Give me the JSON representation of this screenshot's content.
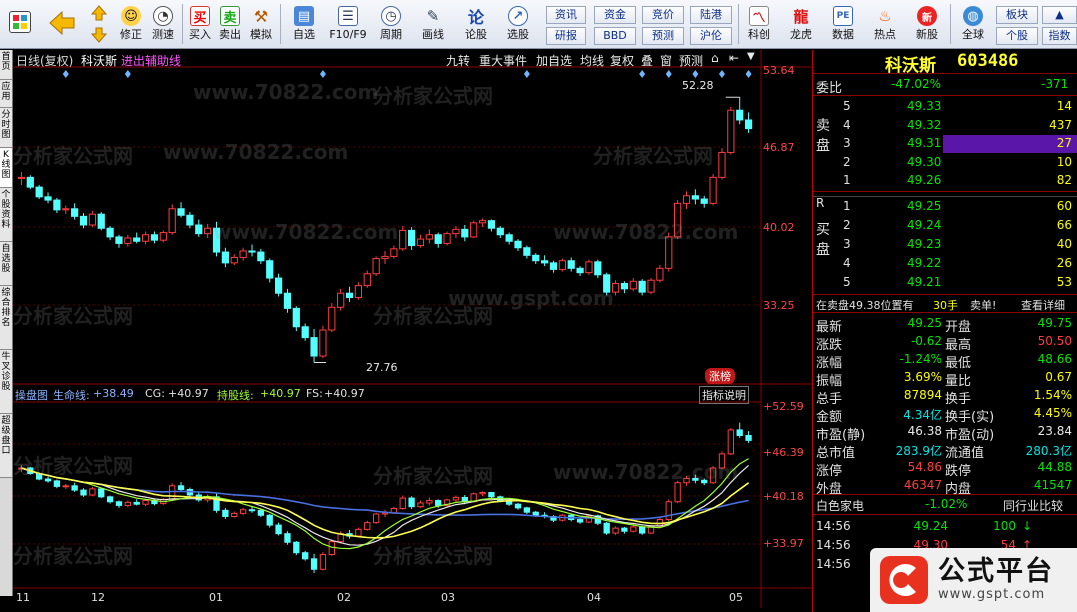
{
  "toolbar": {
    "buttons": [
      {
        "label": "修正",
        "icon": "refresh-icon"
      },
      {
        "label": "测速",
        "icon": "stopwatch-icon"
      },
      {
        "label": "买入",
        "icon": "buy-icon"
      },
      {
        "label": "卖出",
        "icon": "sell-icon"
      },
      {
        "label": "模拟",
        "icon": "gavel-icon"
      },
      {
        "label": "自选",
        "icon": "folder-icon"
      },
      {
        "label": "F10/F9",
        "icon": "document-icon"
      },
      {
        "label": "周期",
        "icon": "clock-icon"
      },
      {
        "label": "画线",
        "icon": "pencil-icon"
      },
      {
        "label": "论股",
        "icon": "discussion-icon"
      },
      {
        "label": "选股",
        "icon": "pick-stock-icon"
      },
      {
        "label": "科创",
        "icon": "chart-icon"
      },
      {
        "label": "龙虎",
        "icon": "dragon-icon"
      },
      {
        "label": "数据",
        "icon": "pe-icon"
      },
      {
        "label": "热点",
        "icon": "hot-icon"
      },
      {
        "label": "新股",
        "icon": "new-stock-icon"
      },
      {
        "label": "全球",
        "icon": "globe-icon"
      }
    ],
    "small_buttons": [
      "资讯",
      "资金",
      "竞价",
      "陆港",
      "研报",
      "BBD",
      "预测",
      "沪伦",
      "板块",
      "个股",
      "指数"
    ]
  },
  "vtabs": [
    "首页",
    "应用",
    "分时图",
    "K线图",
    "个股资料",
    "自选股",
    "综合排名",
    "牛叉诊股",
    "超级盘口"
  ],
  "chart_header": {
    "period": "日线(复权)",
    "stock_name": "科沃斯",
    "aux": "进出辅助线",
    "menu": [
      "九转",
      "重大事件",
      "加自选",
      "均线",
      "复权",
      "叠",
      "窗",
      "预测"
    ]
  },
  "main_axis": {
    "ticks": [
      "53.64",
      "46.87",
      "40.02",
      "33.25"
    ],
    "high_label": "52.28",
    "low_label": "27.76"
  },
  "sub_header": {
    "name": "操盘图",
    "life_label": "生命线:",
    "life_value": "+38.49",
    "cg_label": "CG:",
    "cg_value": "+40.97",
    "hold_label": "持股线:",
    "hold_value": "+40.97",
    "fs_label": "FS:",
    "fs_value": "+40.97",
    "indicator_btn": "指标说明",
    "badge": "涨榜"
  },
  "sub_axis": {
    "ticks": [
      "+52.59",
      "+46.39",
      "+40.18",
      "+33.97"
    ]
  },
  "x_axis": {
    "labels": [
      "11",
      "12",
      "01",
      "02",
      "03",
      "04",
      "05"
    ]
  },
  "chart_data": {
    "type": "candlestick",
    "ylim": [
      26,
      55
    ],
    "candles": [
      [
        44.8,
        45.4,
        44.2,
        44.9
      ],
      [
        44.9,
        45.1,
        43.8,
        44.0
      ],
      [
        44.0,
        44.2,
        42.9,
        43.1
      ],
      [
        43.1,
        43.5,
        42.5,
        42.8
      ],
      [
        42.8,
        43.0,
        41.6,
        41.9
      ],
      [
        41.9,
        42.3,
        41.5,
        42.0
      ],
      [
        42.0,
        42.5,
        41.0,
        41.3
      ],
      [
        41.3,
        41.6,
        40.2,
        40.5
      ],
      [
        40.5,
        41.8,
        40.3,
        41.5
      ],
      [
        41.5,
        41.7,
        40.0,
        40.2
      ],
      [
        40.2,
        40.4,
        39.1,
        39.4
      ],
      [
        39.4,
        39.6,
        38.4,
        38.8
      ],
      [
        38.8,
        39.6,
        38.5,
        39.3
      ],
      [
        39.3,
        39.8,
        38.8,
        39.0
      ],
      [
        39.0,
        39.9,
        38.7,
        39.6
      ],
      [
        39.6,
        39.9,
        38.8,
        39.1
      ],
      [
        39.1,
        40.0,
        38.9,
        39.8
      ],
      [
        39.8,
        42.4,
        39.6,
        42.0
      ],
      [
        42.0,
        42.6,
        41.2,
        41.4
      ],
      [
        41.4,
        41.7,
        40.2,
        40.5
      ],
      [
        40.5,
        41.0,
        39.4,
        39.7
      ],
      [
        39.7,
        40.6,
        39.3,
        40.2
      ],
      [
        40.2,
        40.8,
        37.6,
        38.0
      ],
      [
        38.0,
        38.4,
        36.6,
        37.0
      ],
      [
        37.0,
        37.8,
        36.8,
        37.5
      ],
      [
        37.5,
        38.4,
        37.2,
        38.1
      ],
      [
        38.1,
        38.7,
        37.6,
        38.0
      ],
      [
        38.0,
        38.3,
        36.9,
        37.2
      ],
      [
        37.2,
        37.4,
        35.2,
        35.6
      ],
      [
        35.6,
        36.0,
        33.9,
        34.2
      ],
      [
        34.2,
        34.6,
        32.4,
        32.8
      ],
      [
        32.8,
        33.0,
        30.7,
        31.1
      ],
      [
        31.1,
        31.4,
        29.8,
        30.1
      ],
      [
        30.1,
        30.9,
        27.8,
        28.4
      ],
      [
        28.4,
        31.2,
        28.2,
        30.8
      ],
      [
        30.8,
        33.3,
        30.6,
        32.9
      ],
      [
        32.9,
        34.6,
        32.6,
        34.2
      ],
      [
        34.2,
        34.8,
        33.4,
        33.8
      ],
      [
        33.8,
        35.2,
        33.6,
        34.9
      ],
      [
        34.9,
        36.3,
        34.7,
        36.0
      ],
      [
        36.0,
        37.6,
        35.8,
        37.4
      ],
      [
        37.4,
        38.1,
        36.9,
        37.6
      ],
      [
        37.6,
        38.6,
        37.4,
        38.3
      ],
      [
        38.3,
        40.4,
        38.1,
        40.0
      ],
      [
        40.0,
        40.3,
        38.2,
        38.6
      ],
      [
        38.6,
        39.6,
        38.4,
        39.2
      ],
      [
        39.2,
        40.1,
        38.8,
        39.6
      ],
      [
        39.6,
        39.8,
        38.4,
        38.8
      ],
      [
        38.8,
        39.9,
        38.6,
        39.7
      ],
      [
        39.7,
        40.4,
        39.3,
        40.1
      ],
      [
        40.1,
        40.5,
        39.0,
        39.4
      ],
      [
        39.4,
        40.9,
        39.3,
        40.7
      ],
      [
        40.7,
        41.1,
        40.3,
        40.9
      ],
      [
        40.9,
        41.0,
        39.9,
        40.2
      ],
      [
        40.2,
        40.4,
        39.3,
        39.6
      ],
      [
        39.6,
        39.8,
        38.7,
        39.0
      ],
      [
        39.0,
        39.2,
        38.1,
        38.4
      ],
      [
        38.4,
        38.6,
        37.4,
        37.7
      ],
      [
        37.7,
        37.9,
        36.9,
        37.2
      ],
      [
        37.2,
        37.7,
        36.7,
        37.0
      ],
      [
        37.0,
        37.2,
        36.1,
        36.4
      ],
      [
        36.4,
        37.4,
        36.2,
        37.2
      ],
      [
        37.2,
        37.5,
        36.2,
        36.5
      ],
      [
        36.5,
        36.7,
        35.8,
        36.1
      ],
      [
        36.1,
        37.3,
        35.9,
        37.1
      ],
      [
        37.1,
        37.3,
        35.6,
        35.9
      ],
      [
        35.9,
        36.1,
        34.0,
        34.3
      ],
      [
        34.3,
        35.4,
        34.0,
        35.1
      ],
      [
        35.1,
        35.3,
        34.2,
        34.6
      ],
      [
        34.6,
        35.6,
        34.4,
        35.3
      ],
      [
        35.3,
        35.5,
        34.0,
        34.3
      ],
      [
        34.3,
        35.6,
        34.1,
        35.4
      ],
      [
        35.4,
        36.8,
        35.2,
        36.5
      ],
      [
        36.5,
        39.8,
        36.2,
        39.4
      ],
      [
        39.4,
        42.8,
        39.2,
        42.5
      ],
      [
        42.5,
        43.6,
        42.0,
        43.2
      ],
      [
        43.2,
        43.8,
        42.4,
        42.9
      ],
      [
        42.9,
        43.2,
        42.1,
        42.5
      ],
      [
        42.5,
        45.2,
        42.3,
        44.9
      ],
      [
        44.9,
        47.6,
        44.7,
        47.2
      ],
      [
        47.2,
        51.4,
        47.0,
        51.1
      ],
      [
        51.1,
        52.3,
        49.8,
        50.2
      ],
      [
        50.2,
        50.9,
        49.0,
        49.4
      ]
    ]
  },
  "right_panel": {
    "stock_name": "科沃斯",
    "stock_code": "603486",
    "weibi_label": "委比",
    "weibi_value": "-47.02%",
    "weibi_diff": "-371",
    "sell_label": "卖盘",
    "buy_label": "买盘",
    "asks": [
      {
        "lvl": "5",
        "price": "49.33",
        "vol": "14"
      },
      {
        "lvl": "4",
        "price": "49.32",
        "vol": "437"
      },
      {
        "lvl": "3",
        "price": "49.31",
        "vol": "27"
      },
      {
        "lvl": "2",
        "price": "49.30",
        "vol": "10"
      },
      {
        "lvl": "1",
        "price": "49.26",
        "vol": "82"
      }
    ],
    "bids": [
      {
        "lvl": "1",
        "price": "49.25",
        "vol": "60"
      },
      {
        "lvl": "2",
        "price": "49.24",
        "vol": "66"
      },
      {
        "lvl": "3",
        "price": "49.23",
        "vol": "40"
      },
      {
        "lvl": "4",
        "price": "49.22",
        "vol": "26"
      },
      {
        "lvl": "5",
        "price": "49.21",
        "vol": "53"
      }
    ],
    "r_label": "R",
    "order_note": "在卖盘49.38位置有",
    "order_note_vol": "30手",
    "order_note_tag": "卖单!",
    "detail_btn": "查看详细",
    "stats": [
      {
        "l1": "最新",
        "v1": "49.25",
        "c1": "green",
        "l2": "开盘",
        "v2": "49.75",
        "c2": "green"
      },
      {
        "l1": "涨跌",
        "v1": "-0.62",
        "c1": "green",
        "l2": "最高",
        "v2": "50.50",
        "c2": "red"
      },
      {
        "l1": "涨幅",
        "v1": "-1.24%",
        "c1": "green",
        "l2": "最低",
        "v2": "48.66",
        "c2": "green"
      },
      {
        "l1": "振幅",
        "v1": "3.69%",
        "c1": "yellow",
        "l2": "量比",
        "v2": "0.67",
        "c2": "yellow"
      },
      {
        "l1": "总手",
        "v1": "87894",
        "c1": "yellow",
        "l2": "换手",
        "v2": "1.54%",
        "c2": "yellow"
      },
      {
        "l1": "金额",
        "v1": "4.34亿",
        "c1": "cyan",
        "l2": "换手(实)",
        "v2": "4.45%",
        "c2": "yellow"
      },
      {
        "l1": "市盈(静)",
        "v1": "46.38",
        "c1": "white",
        "l2": "市盈(动)",
        "v2": "23.84",
        "c2": "white"
      },
      {
        "l1": "总市值",
        "v1": "283.9亿",
        "c1": "cyan",
        "l2": "流通值",
        "v2": "280.3亿",
        "c2": "cyan"
      },
      {
        "l1": "涨停",
        "v1": "54.86",
        "c1": "red",
        "l2": "跌停",
        "v2": "44.88",
        "c2": "green"
      },
      {
        "l1": "外盘",
        "v1": "46347",
        "c1": "red",
        "l2": "内盘",
        "v2": "41547",
        "c2": "green"
      }
    ],
    "industry": "白色家电",
    "industry_chg": "-1.02%",
    "compare_btn": "同行业比较",
    "ticks": [
      {
        "time": "14:56",
        "price": "49.24",
        "vol": "100",
        "dir": "down"
      },
      {
        "time": "14:56",
        "price": "49.30",
        "vol": "54",
        "dir": "up"
      },
      {
        "time": "14:56",
        "price": "",
        "vol": "",
        "dir": ""
      }
    ]
  },
  "watermarks": [
    "www.70822.com",
    "分析家公式网",
    "www.gspt.com"
  ],
  "logo": {
    "name": "公式平台",
    "url": "www.gspt.com"
  }
}
